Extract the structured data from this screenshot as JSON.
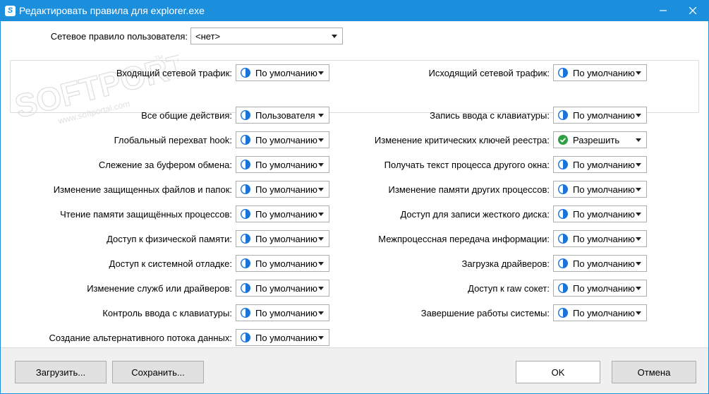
{
  "window": {
    "title": "Редактировать правила для explorer.exe",
    "app_icon_letter": "S",
    "minimize_icon": "minimize-icon",
    "close_icon": "close-icon"
  },
  "watermark": {
    "main": "SOFTPORTAL",
    "url": "www.softportal.com",
    "tm": "TM"
  },
  "user_rule": {
    "label": "Сетевое правило пользователя:",
    "value": "<нет>"
  },
  "traffic": {
    "incoming_label": "Входящий сетевой трафик:",
    "incoming_value": "По умолчанию",
    "outgoing_label": "Исходящий сетевой трафик:",
    "outgoing_value": "По умолчанию"
  },
  "left_rules": [
    {
      "label": "Все общие действия:",
      "value": "Пользователя",
      "icon": "default-icon"
    },
    {
      "label": "Глобальный перехват hook:",
      "value": "По умолчанию",
      "icon": "default-icon"
    },
    {
      "label": "Слежение за буфером обмена:",
      "value": "По умолчанию",
      "icon": "default-icon"
    },
    {
      "label": "Изменение защищенных файлов и папок:",
      "value": "По умолчанию",
      "icon": "default-icon"
    },
    {
      "label": "Чтение памяти защищённых процессов:",
      "value": "По умолчанию",
      "icon": "default-icon"
    },
    {
      "label": "Доступ к физической памяти:",
      "value": "По умолчанию",
      "icon": "default-icon"
    },
    {
      "label": "Доступ к системной отладке:",
      "value": "По умолчанию",
      "icon": "default-icon"
    },
    {
      "label": "Изменение служб или драйверов:",
      "value": "По умолчанию",
      "icon": "default-icon"
    },
    {
      "label": "Контроль ввода с клавиатуры:",
      "value": "По умолчанию",
      "icon": "default-icon"
    },
    {
      "label": "Создание альтернативного потока данных:",
      "value": "По умолчанию",
      "icon": "default-icon"
    }
  ],
  "right_rules": [
    {
      "label": "Запись ввода с клавиатуры:",
      "value": "По умолчанию",
      "icon": "default-icon"
    },
    {
      "label": "Изменение критических ключей реестра:",
      "value": "Разрешить",
      "icon": "allow-check-icon"
    },
    {
      "label": "Получать текст процесса другого окна:",
      "value": "По умолчанию",
      "icon": "default-icon"
    },
    {
      "label": "Изменение памяти других процессов:",
      "value": "По умолчанию",
      "icon": "default-icon"
    },
    {
      "label": "Доступ для записи жесткого диска:",
      "value": "По умолчанию",
      "icon": "default-icon"
    },
    {
      "label": "Межпроцессная передача информации:",
      "value": "По умолчанию",
      "icon": "default-icon"
    },
    {
      "label": "Загрузка драйверов:",
      "value": "По умолчанию",
      "icon": "default-icon"
    },
    {
      "label": "Доступ к raw сокет:",
      "value": "По умолчанию",
      "icon": "default-icon"
    },
    {
      "label": "Завершение работы системы:",
      "value": "По умолчанию",
      "icon": "default-icon"
    }
  ],
  "buttons": {
    "load": "Загрузить...",
    "save": "Сохранить...",
    "ok": "OK",
    "cancel": "Отмена"
  },
  "colors": {
    "titlebar": "#1c8fdc",
    "default_icon": "#1a73d9",
    "allow_icon": "#2ea043"
  }
}
